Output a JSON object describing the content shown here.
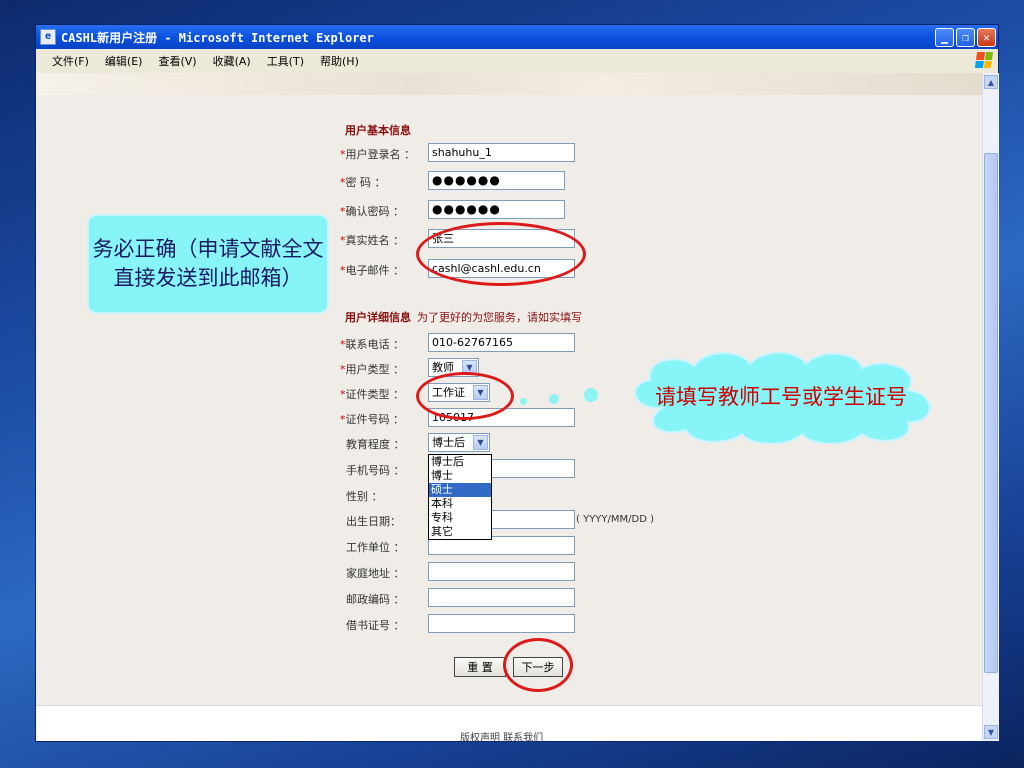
{
  "window": {
    "title": "CASHL新用户注册 - Microsoft Internet Explorer"
  },
  "menu": [
    "文件(F)",
    "编辑(E)",
    "查看(V)",
    "收藏(A)",
    "工具(T)",
    "帮助(H)"
  ],
  "form": {
    "basic_title": "用户基本信息",
    "login_label": "用户登录名 ：",
    "login_value": "shahuhu_1",
    "password_label": "密 码 ：",
    "password_value": "●●●●●●",
    "confirm_label": "确认密码 ：",
    "confirm_value": "●●●●●●",
    "realname_label": "真实姓名 ：",
    "realname_value": "张三",
    "email_label": "电子邮件 ：",
    "email_value": "cashl@cashl.edu.cn",
    "detail_title": "用户详细信息",
    "detail_note": "为了更好的为您服务，请如实填写",
    "phone_label": "联系电话 ：",
    "phone_value": "010-62767165",
    "usertype_label": "用户类型 ：",
    "usertype_value": "教师",
    "idtype_label": "证件类型 ：",
    "idtype_value": "工作证",
    "idnum_label": "证件号码 ：",
    "idnum_value": "105017",
    "edu_label": "教育程度 ：",
    "edu_value": "博士后",
    "edu_options": [
      "博士后",
      "博士",
      "硕士",
      "本科",
      "专科",
      "其它"
    ],
    "mobile_label": "手机号码 ：",
    "gender_label": "性别 ：",
    "birth_label": "出生日期：",
    "birth_hint": "( YYYY/MM/DD )",
    "work_label": "工作单位 ：",
    "home_label": "家庭地址 ：",
    "zip_label": "邮政编码 ：",
    "library_label": "借书证号 ：",
    "reset_button": "重 置",
    "next_button": "下一步"
  },
  "footer": "版权声明 联系我们",
  "annotations": {
    "email_callout": "务必正确（申请文献全文直接发送到此邮箱）",
    "id_cloud": "请填写教师工号或学生证号"
  },
  "colors": {
    "section_title": "#8a0f0f",
    "required_mark": "#cc0000",
    "highlight_ring": "#dd1a1a",
    "callout_bg": "#87f5f7",
    "dropdown_selected": "#316ac5"
  }
}
